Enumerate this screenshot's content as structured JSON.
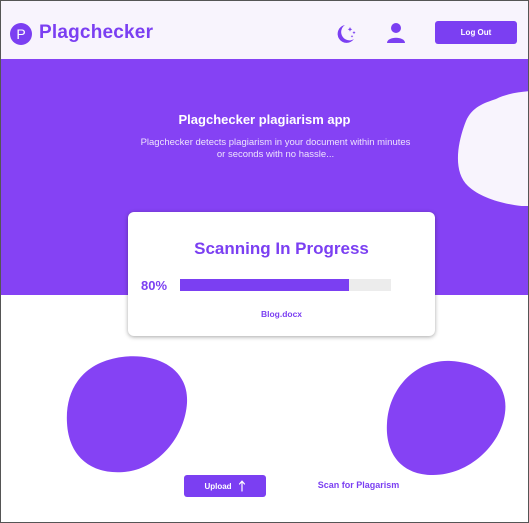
{
  "header": {
    "logo_letter": "P",
    "brand": "Plagchecker",
    "logout_label": "Log Out",
    "icons": [
      "moon-stars-icon",
      "user-icon"
    ]
  },
  "hero": {
    "title": "Plagchecker plagiarism app",
    "description": "Plagchecker detects plagiarism in your document within minutes or seconds  with no hassle..."
  },
  "scan_card": {
    "title": "Scanning  In Progress",
    "progress_label": "80%",
    "progress_value": 0.8,
    "file_name": "Blog.docx"
  },
  "actions": {
    "upload_label": "Upload",
    "upload_icon": "arrow-up-icon",
    "scan_label": "Scan for Plagarism"
  },
  "colors": {
    "primary": "#7b3ff2",
    "hero_bg": "#8542f4",
    "header_bg": "#f8f4fd",
    "track": "#ececec"
  }
}
